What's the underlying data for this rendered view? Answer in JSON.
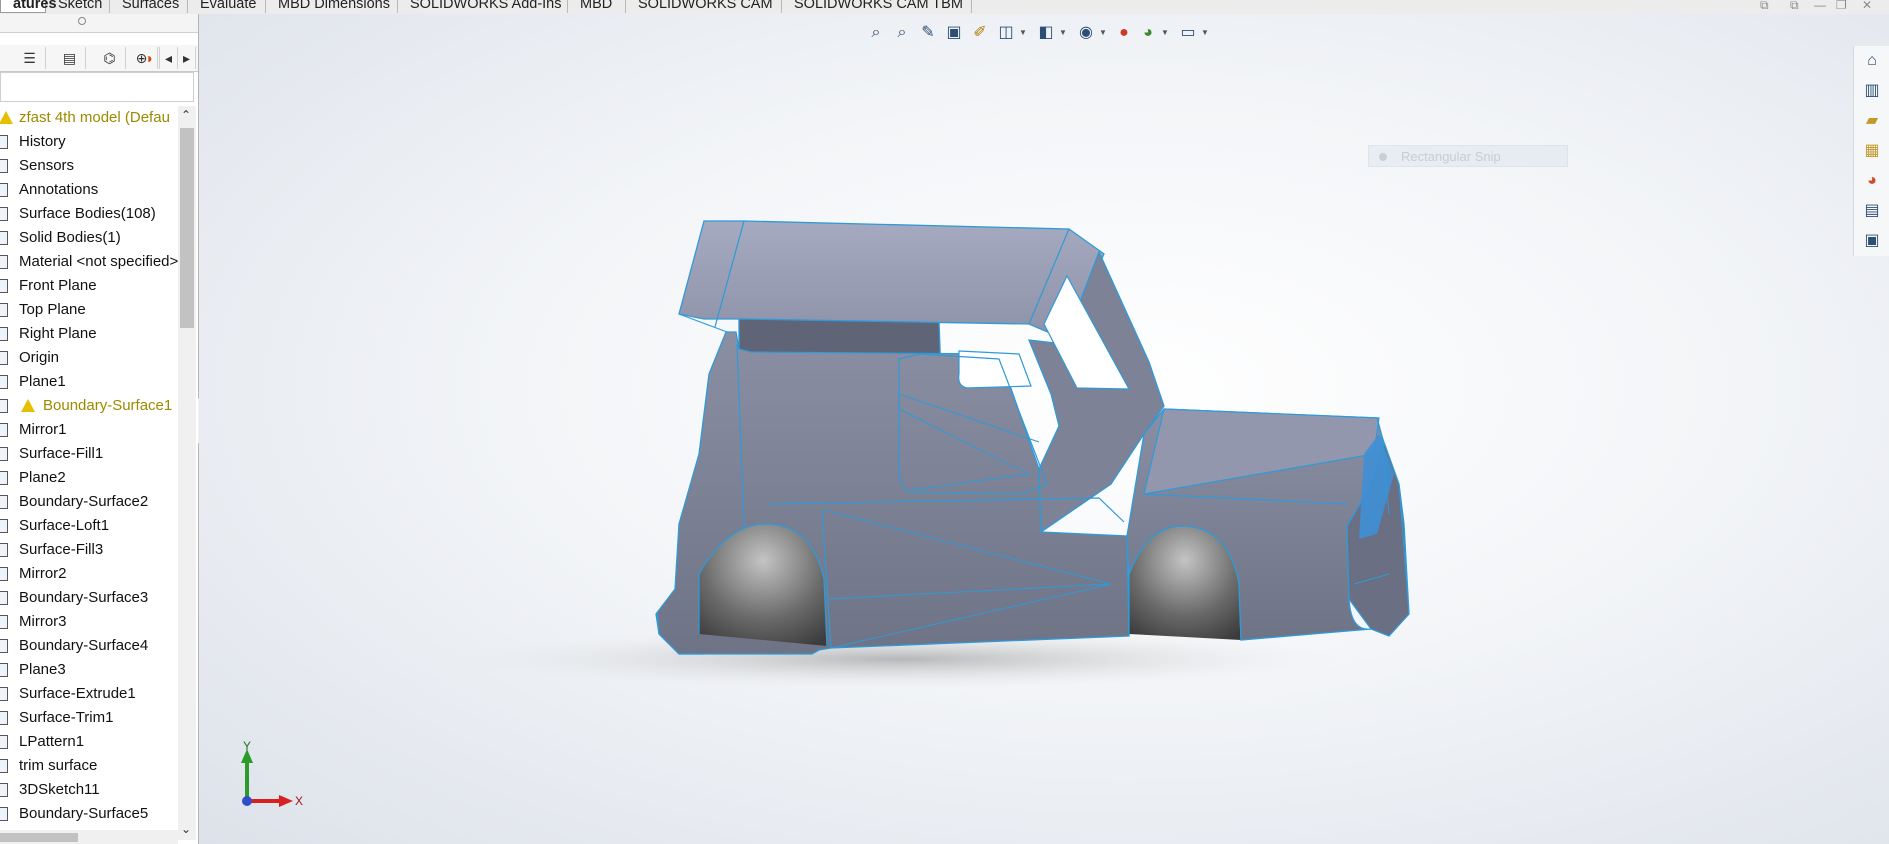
{
  "tabs": [
    {
      "label": "atures",
      "active": true
    },
    {
      "label": "Sketch",
      "active": false
    },
    {
      "label": "Surfaces",
      "active": false
    },
    {
      "label": "Evaluate",
      "active": false
    },
    {
      "label": "MBD Dimensions",
      "active": false
    },
    {
      "label": "SOLIDWORKS Add-Ins",
      "active": false
    },
    {
      "label": "MBD",
      "active": false
    },
    {
      "label": "SOLIDWORKS CAM",
      "active": false
    },
    {
      "label": "SOLIDWORKS CAM TBM",
      "active": false
    }
  ],
  "feature_manager": {
    "root": "zfast 4th model  (Defau",
    "items": [
      {
        "label": "History",
        "icon": "history-icon"
      },
      {
        "label": "Sensors",
        "icon": "sensors-icon"
      },
      {
        "label": "Annotations",
        "icon": "annotations-icon"
      },
      {
        "label": "Surface Bodies(108)",
        "icon": "surface-bodies-icon"
      },
      {
        "label": "Solid Bodies(1)",
        "icon": "solid-bodies-icon"
      },
      {
        "label": "Material <not specified>",
        "icon": "material-icon"
      },
      {
        "label": "Front Plane",
        "icon": "plane-icon"
      },
      {
        "label": "Top Plane",
        "icon": "plane-icon"
      },
      {
        "label": "Right Plane",
        "icon": "plane-icon"
      },
      {
        "label": "Origin",
        "icon": "origin-icon"
      },
      {
        "label": "Plane1",
        "icon": "plane-icon"
      },
      {
        "label": "Boundary-Surface1",
        "icon": "boundary-surface-icon",
        "warning": true
      },
      {
        "label": "Mirror1",
        "icon": "mirror-icon"
      },
      {
        "label": "Surface-Fill1",
        "icon": "surface-fill-icon"
      },
      {
        "label": "Plane2",
        "icon": "plane-icon"
      },
      {
        "label": "Boundary-Surface2",
        "icon": "boundary-surface-icon"
      },
      {
        "label": "Surface-Loft1",
        "icon": "surface-loft-icon"
      },
      {
        "label": "Surface-Fill3",
        "icon": "surface-fill-icon"
      },
      {
        "label": "Mirror2",
        "icon": "mirror-icon"
      },
      {
        "label": "Boundary-Surface3",
        "icon": "boundary-surface-icon"
      },
      {
        "label": "Mirror3",
        "icon": "mirror-icon"
      },
      {
        "label": "Boundary-Surface4",
        "icon": "boundary-surface-icon"
      },
      {
        "label": "Plane3",
        "icon": "plane-icon"
      },
      {
        "label": "Surface-Extrude1",
        "icon": "surface-extrude-icon"
      },
      {
        "label": "Surface-Trim1",
        "icon": "surface-trim-icon"
      },
      {
        "label": "LPattern1",
        "icon": "linear-pattern-icon"
      },
      {
        "label": "trim surface",
        "icon": "folder-icon"
      },
      {
        "label": "3DSketch11",
        "icon": "3dsketch-icon"
      },
      {
        "label": "Boundary-Surface5",
        "icon": "boundary-surface-icon"
      }
    ]
  },
  "fm_tabs": [
    "feature-manager-tab",
    "property-manager-tab",
    "configuration-manager-tab",
    "dimxpert-manager-tab",
    "display-manager-tab"
  ],
  "viewport": {
    "snip_label": "Rectangular Snip",
    "triad": {
      "x": "X",
      "y": "Y"
    },
    "headsup_icons": [
      "zoom-to-fit-icon",
      "zoom-to-area-icon",
      "previous-view-icon",
      "section-view-icon",
      "dynamic-annotation-icon",
      "view-orientation-icon",
      "display-style-icon",
      "hide-show-items-icon",
      "edit-appearance-icon",
      "apply-scene-icon",
      "view-settings-icon"
    ]
  },
  "task_pane": [
    "home-icon",
    "design-library-icon",
    "file-explorer-icon",
    "view-palette-icon",
    "appearances-icon",
    "custom-properties-icon",
    "forum-icon"
  ],
  "colors": {
    "body_fill": "#7f8497",
    "edge": "#2f9ad8",
    "warning": "#e6c000"
  }
}
